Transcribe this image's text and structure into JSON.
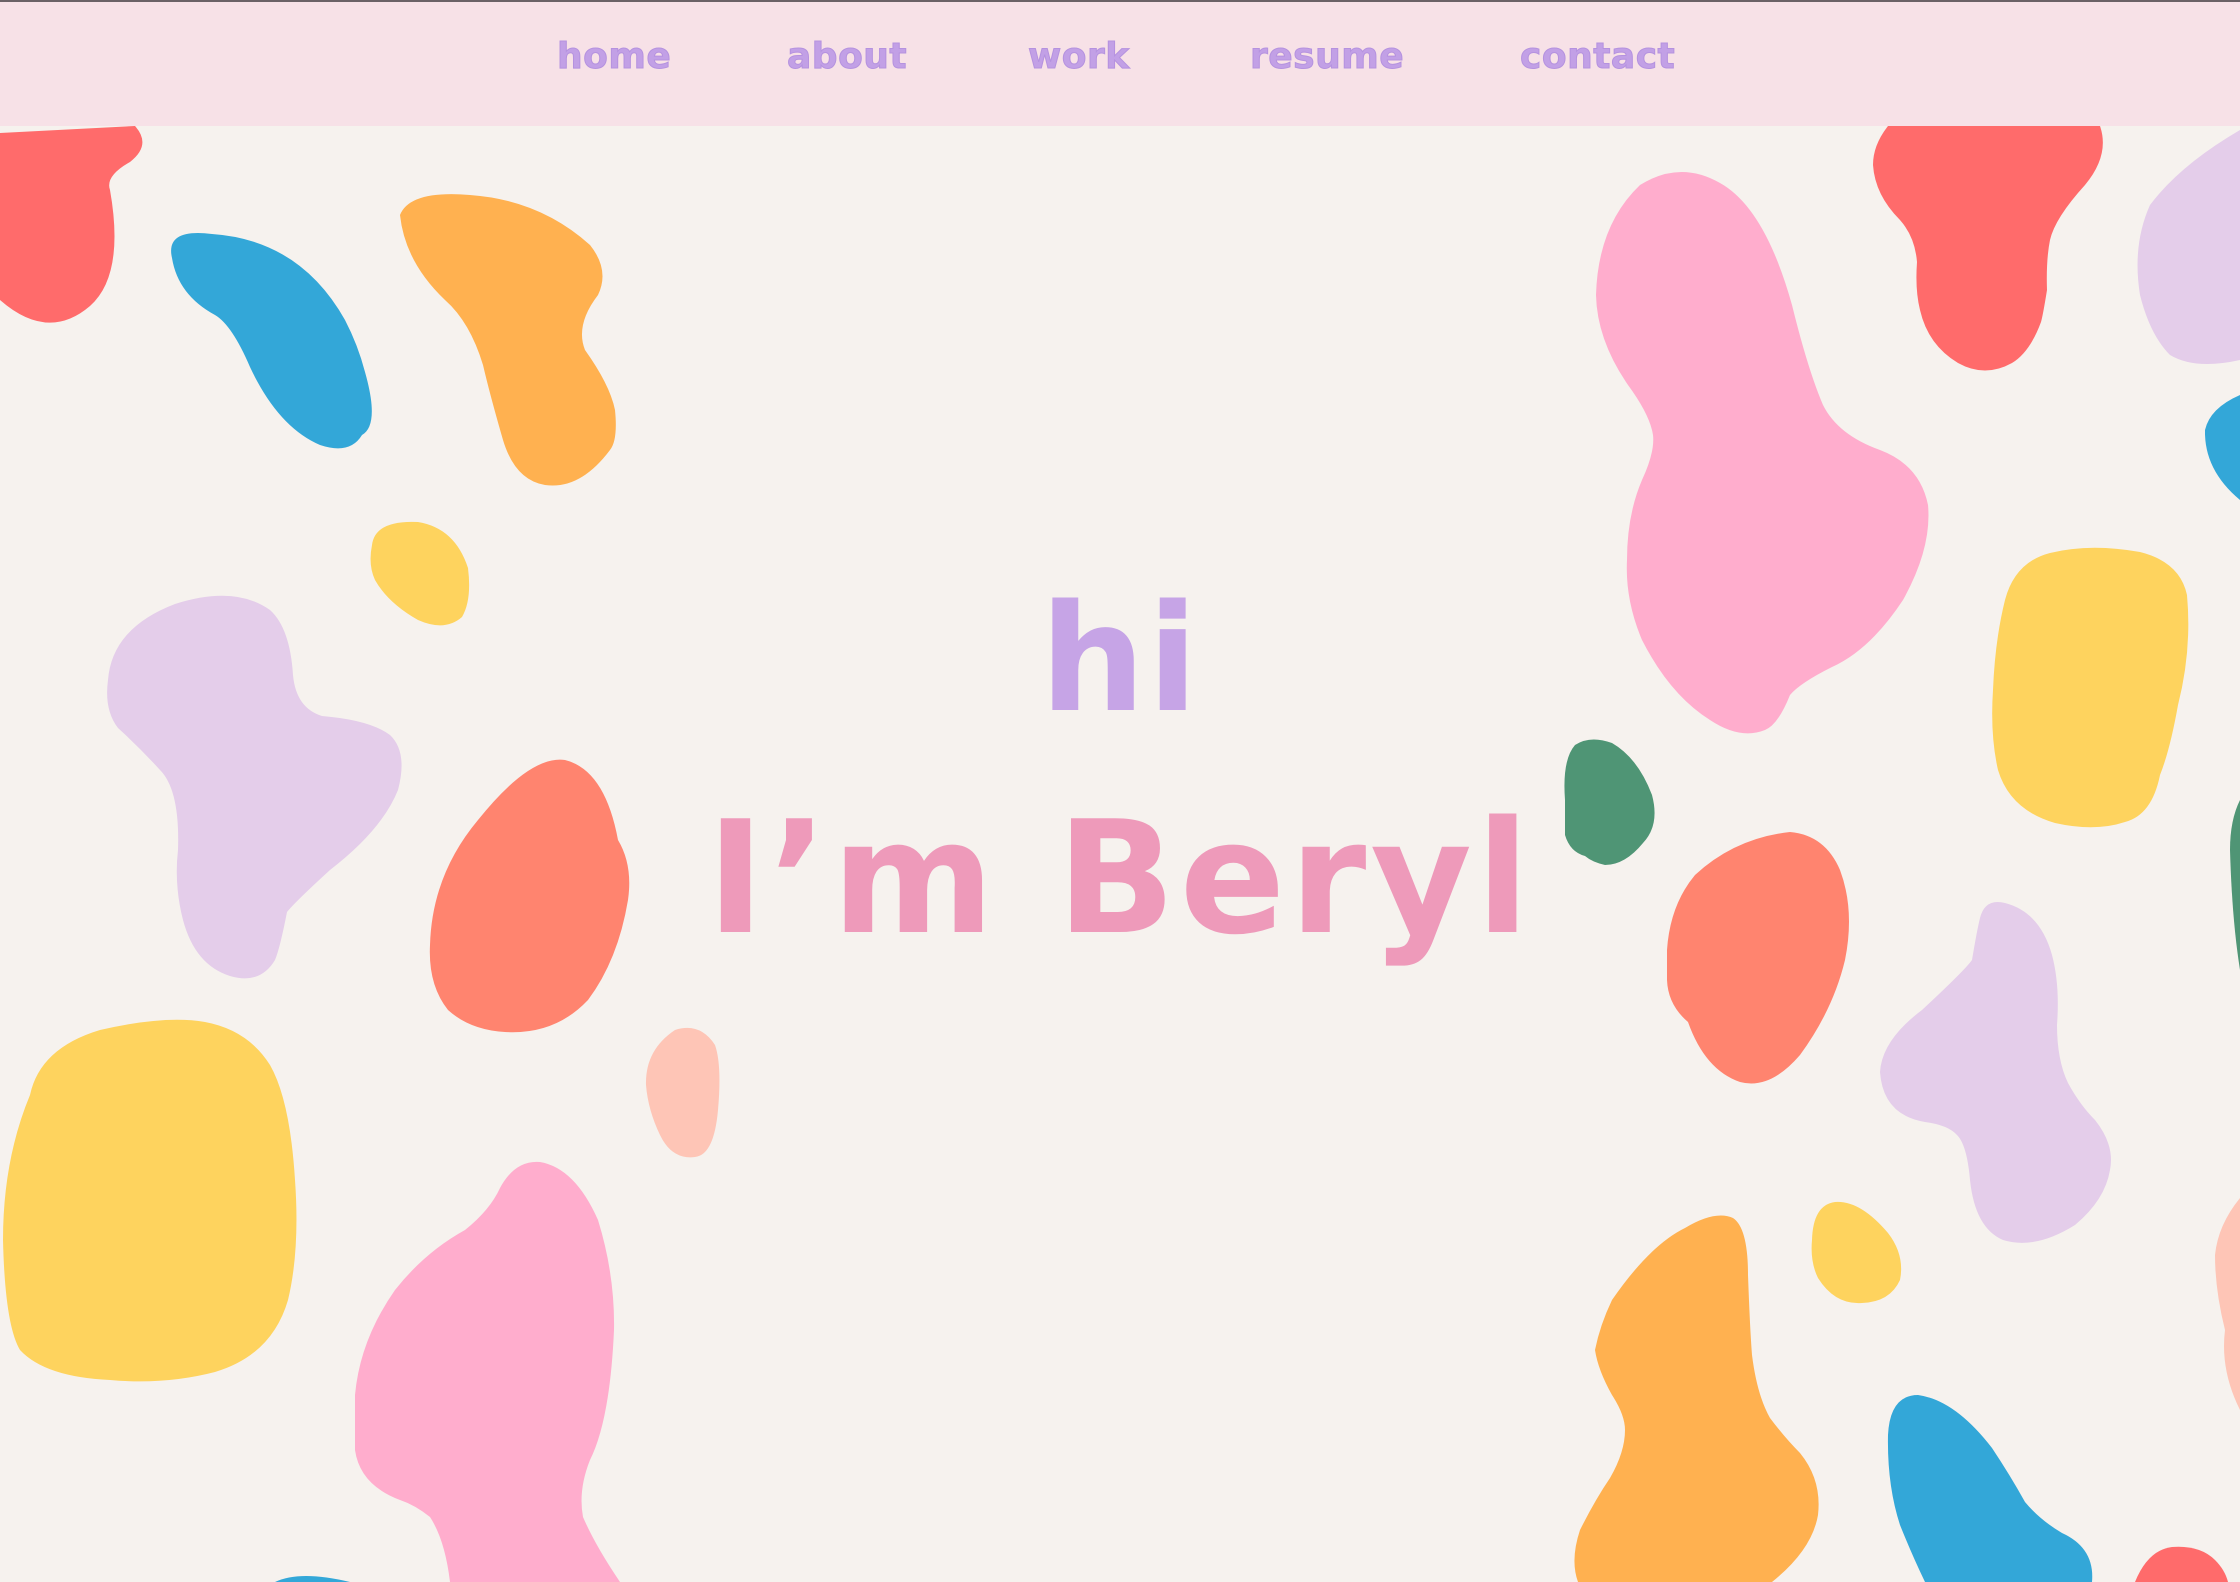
{
  "nav": {
    "items": [
      {
        "label": "home"
      },
      {
        "label": "about"
      },
      {
        "label": "work"
      },
      {
        "label": "resume"
      },
      {
        "label": "contact"
      }
    ]
  },
  "hero": {
    "greeting": "hi",
    "name": "I’m Beryl"
  },
  "colors": {
    "background": "#f6f2ee",
    "navbar": "#f7e1e7",
    "nav_text": "#c2a0e6",
    "greeting": "#c6a4e6",
    "name": "#ee9aba",
    "blob_red": "#ff6b6b",
    "blob_blue": "#33a7d8",
    "blob_orange": "#ffb150",
    "blob_yellow": "#fed35e",
    "blob_lavender": "#e4cdea",
    "blob_coral": "#ff846f",
    "blob_pink": "#ffadcd",
    "blob_peach": "#fec5b6",
    "blob_green": "#4f9575"
  }
}
